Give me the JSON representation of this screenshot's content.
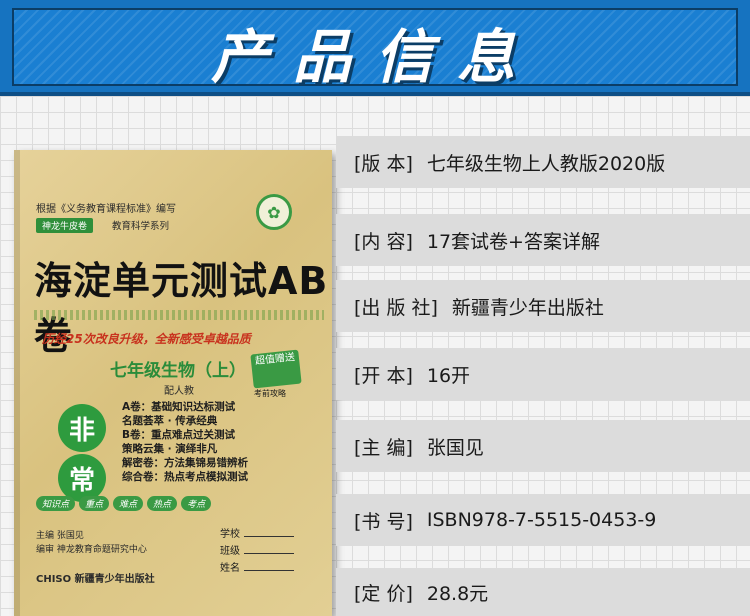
{
  "header": {
    "title": "产品信息"
  },
  "cover": {
    "basis": "根据《义务教育课程标准》编写",
    "series_tag": "神龙牛皮卷",
    "series": "教育科学系列",
    "title": "海淀单元测试AB卷",
    "slogan": "历经25次改良升级，全新感受卓越品质",
    "grade": "七年级生物（上）",
    "edition": "配人教",
    "gift": "超值赠送",
    "gift_sub": "考前攻略",
    "circle_1": "非",
    "circle_2": "常",
    "contents": [
      "A卷：基础知识达标测试",
      "名题荟萃 · 传承经典",
      "B卷：重点难点过关测试",
      "策略云集 · 演绎非凡",
      "解密卷：方法集锦易错辨析",
      "综合卷：热点考点模拟测试"
    ],
    "tags": [
      "知识点",
      "重点",
      "难点",
      "热点",
      "考点"
    ],
    "editor": "主编  张国见",
    "compiler": "编审  神龙教育命题研究中心",
    "publisher": "CHISO  新疆青少年出版社",
    "fields": [
      "学校",
      "班级",
      "姓名"
    ]
  },
  "info": [
    {
      "label": "[版 本]",
      "value": "七年级生物上人教版2020版"
    },
    {
      "label": "[内 容]",
      "value": "17套试卷+答案详解"
    },
    {
      "label": "[出 版 社]",
      "value": "新疆青少年出版社"
    },
    {
      "label": "[开 本]",
      "value": "16开"
    },
    {
      "label": "[主 编]",
      "value": "张国见"
    },
    {
      "label": "[书 号]",
      "value": "ISBN978-7-5515-0453-9"
    },
    {
      "label": "[定 价]",
      "value": "28.8元"
    }
  ]
}
